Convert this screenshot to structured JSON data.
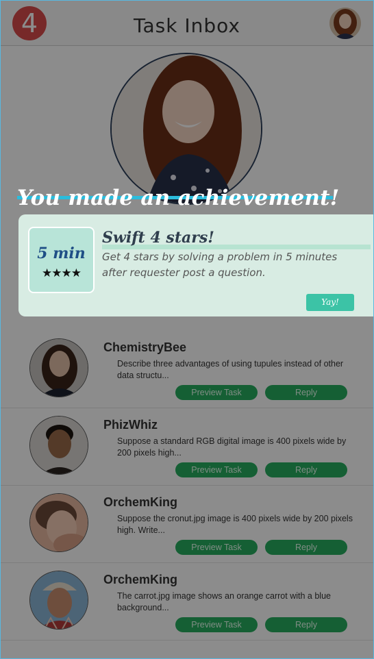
{
  "header": {
    "badge_count": "4",
    "title": "Task Inbox"
  },
  "achievement": {
    "heading": "You made an achievement!",
    "badge_time": "5 min",
    "badge_stars": "★★★★",
    "title": "Swift 4 stars!",
    "description": "Get 4 stars by solving a problem in 5 minutes after requester post a question.",
    "button_label": "Yay!"
  },
  "tasks": [
    {
      "user": "ChemistryBee",
      "description": "Describe three advantages of using tupules instead of other data structu...",
      "preview_label": "Preview Task",
      "reply_label": "Reply"
    },
    {
      "user": "PhizWhiz",
      "description": "Suppose a standard RGB digital image is 400 pixels wide by 200 pixels high...",
      "preview_label": "Preview Task",
      "reply_label": "Reply"
    },
    {
      "user": "OrchemKing",
      "description": "Suppose the cronut.jpg image is 400 pixels wide by 200 pixels high. Write...",
      "preview_label": "Preview Task",
      "reply_label": "Reply"
    },
    {
      "user": "OrchemKing",
      "description": "The carrot.jpg image shows an orange carrot with a blue background...",
      "preview_label": "Preview Task",
      "reply_label": "Reply"
    }
  ],
  "colors": {
    "accent_green": "#27ae60",
    "badge_red": "#d94b4b",
    "achievement_teal": "#3cc3a6",
    "heading_underline": "#2bbcdc"
  }
}
